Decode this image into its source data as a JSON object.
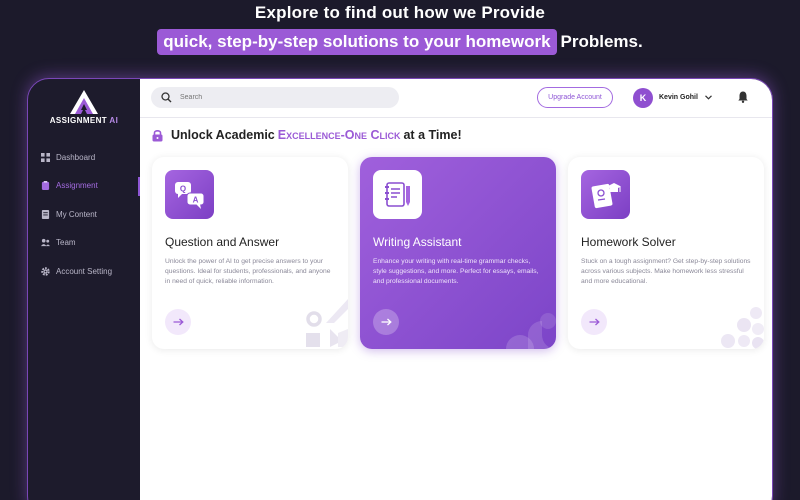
{
  "hero": {
    "line1": "Explore to find out how we Provide",
    "highlight": "quick, step-by-step solutions to your homework",
    "suffix": "Problems."
  },
  "brand": {
    "name": "ASSIGNMENT",
    "suffix": "AI",
    "accent": "#9b5ad6"
  },
  "sidebar": {
    "items": [
      {
        "label": "Dashboard",
        "icon": "grid-icon",
        "active": false
      },
      {
        "label": "Assignment",
        "icon": "clipboard-icon",
        "active": true
      },
      {
        "label": "My Content",
        "icon": "document-icon",
        "active": false
      },
      {
        "label": "Team",
        "icon": "team-icon",
        "active": false
      },
      {
        "label": "Account Setting",
        "icon": "gear-icon",
        "active": false
      }
    ]
  },
  "topbar": {
    "search_placeholder": "Search",
    "upgrade_label": "Upgrade Account",
    "user": {
      "initial": "K",
      "name": "Kevin Gohil"
    }
  },
  "heading": {
    "prefix": "Unlock Academic",
    "highlight": "Excellence-One Click",
    "suffix": "at a Time!"
  },
  "cards": [
    {
      "title": "Question and Answer",
      "description": "Unlock the power of AI to get precise answers to your questions. Ideal for students, professionals, and anyone in need of quick, reliable information.",
      "icon": "qa-bubbles-icon"
    },
    {
      "title": "Writing Assistant",
      "description": "Enhance your writing with real-time grammar checks, style suggestions, and more. Perfect for essays, emails, and professional documents.",
      "icon": "notebook-pen-icon",
      "featured": true
    },
    {
      "title": "Homework Solver",
      "description": "Stuck on a tough assignment? Get step-by-step solutions across various subjects. Make homework less stressful and more educational.",
      "icon": "homework-graduation-icon"
    }
  ]
}
